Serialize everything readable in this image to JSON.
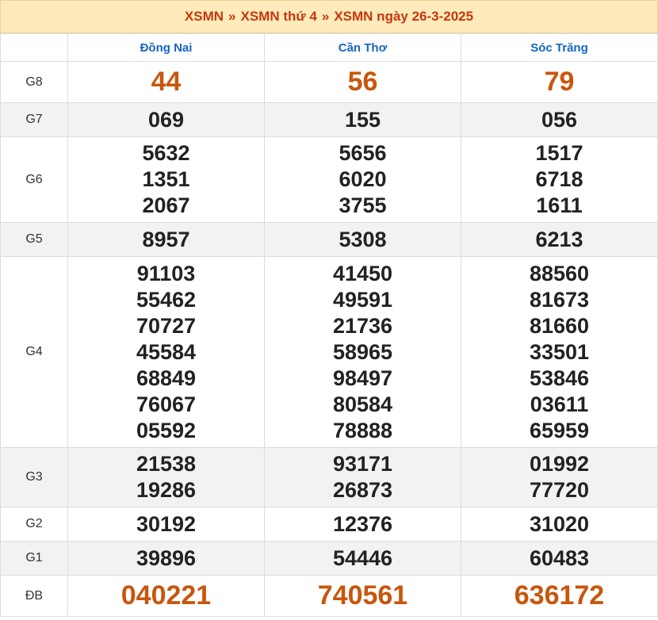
{
  "breadcrumb": {
    "item1": "XSMN",
    "sep1": "»",
    "item2": "XSMN thứ 4",
    "sep2": "»",
    "item3": "XSMN ngày 26-3-2025"
  },
  "colors": {
    "accent": "#c8360c",
    "header_bg": "#fdebbb",
    "province": "#1565c0",
    "highlight_number": "#c8560c"
  },
  "provinces": [
    "Đồng Nai",
    "Cần Thơ",
    "Sóc Trăng"
  ],
  "prizes": [
    {
      "label": "G8",
      "values": [
        [
          "44"
        ],
        [
          "56"
        ],
        [
          "79"
        ]
      ]
    },
    {
      "label": "G7",
      "values": [
        [
          "069"
        ],
        [
          "155"
        ],
        [
          "056"
        ]
      ]
    },
    {
      "label": "G6",
      "values": [
        [
          "5632",
          "1351",
          "2067"
        ],
        [
          "5656",
          "6020",
          "3755"
        ],
        [
          "1517",
          "6718",
          "1611"
        ]
      ]
    },
    {
      "label": "G5",
      "values": [
        [
          "8957"
        ],
        [
          "5308"
        ],
        [
          "6213"
        ]
      ]
    },
    {
      "label": "G4",
      "values": [
        [
          "91103",
          "55462",
          "70727",
          "45584",
          "68849",
          "76067",
          "05592"
        ],
        [
          "41450",
          "49591",
          "21736",
          "58965",
          "98497",
          "80584",
          "78888"
        ],
        [
          "88560",
          "81673",
          "81660",
          "33501",
          "53846",
          "03611",
          "65959"
        ]
      ]
    },
    {
      "label": "G3",
      "values": [
        [
          "21538",
          "19286"
        ],
        [
          "93171",
          "26873"
        ],
        [
          "01992",
          "77720"
        ]
      ]
    },
    {
      "label": "G2",
      "values": [
        [
          "30192"
        ],
        [
          "12376"
        ],
        [
          "31020"
        ]
      ]
    },
    {
      "label": "G1",
      "values": [
        [
          "39896"
        ],
        [
          "54446"
        ],
        [
          "60483"
        ]
      ]
    },
    {
      "label": "ĐB",
      "values": [
        [
          "040221"
        ],
        [
          "740561"
        ],
        [
          "636172"
        ]
      ]
    }
  ]
}
